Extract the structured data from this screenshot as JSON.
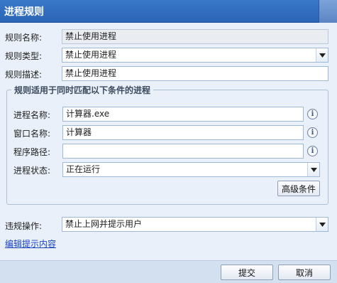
{
  "window": {
    "title": "进程规则"
  },
  "rule": {
    "name_label": "规则名称:",
    "name_value": "禁止使用进程",
    "type_label": "规则类型:",
    "type_value": "禁止使用进程",
    "desc_label": "规则描述:",
    "desc_value": "禁止使用进程"
  },
  "conditions": {
    "legend": "规则适用于同时匹配以下条件的进程",
    "process_name_label": "进程名称:",
    "process_name_value": "计算器.exe",
    "window_name_label": "窗口名称:",
    "window_name_value": "计算器",
    "program_path_label": "程序路径:",
    "program_path_value": "",
    "process_state_label": "进程状态:",
    "process_state_value": "正在运行",
    "advanced_button": "高级条件"
  },
  "violation": {
    "label": "违规操作:",
    "value": "禁止上网并提示用户",
    "edit_link": "编辑提示内容"
  },
  "footer": {
    "submit_label": "提交",
    "cancel_label": "取消"
  },
  "icons": {
    "info": "info-icon",
    "dropdown": "chevron-down-icon"
  }
}
